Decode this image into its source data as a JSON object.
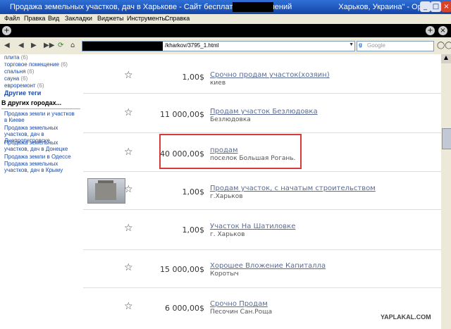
{
  "window": {
    "title_left": "Продажа земельных участков, дач в Харькове - Сайт бесплатных объявлений",
    "title_right": "Харьков, Украина\" - Opera",
    "minimize": "_",
    "maximize": "□",
    "close": "×"
  },
  "menu": [
    "Файл",
    "Правка",
    "Вид",
    "Закладки",
    "Виджеты",
    "Инструменты",
    "Справка"
  ],
  "address_bar": {
    "url": "/kharkov/3795_1.html"
  },
  "search": {
    "placeholder": "Google"
  },
  "sidebar": {
    "tags": [
      {
        "label": "плита",
        "count": "(6)"
      },
      {
        "label": "торговое помещение",
        "count": "(6)"
      },
      {
        "label": "спальня",
        "count": "(6)"
      },
      {
        "label": "сауна",
        "count": "(6)"
      },
      {
        "label": "евроремонт",
        "count": "(6)"
      }
    ],
    "other_tags": "Другие теги",
    "other_cities_heading": "В других городах...",
    "cities": [
      "Продажа земли и участков в Киеве",
      "Продажа земельных участков, дач в Днепропетровске",
      "Продажа земельных участков, дач в Донецке",
      "Продажа земли в Одессе",
      "Продажа земельных участков, дач в Крыму"
    ]
  },
  "listings": [
    {
      "price": "1,00$",
      "title": "Срочно продам участок(хозяин)",
      "location": "киев"
    },
    {
      "price": "11 000,00$",
      "title": "Продам участок Безлюдовка",
      "location": "Безлюдовка"
    },
    {
      "price": "40 000,00$",
      "title": "продам",
      "location": "поселок Большая Рогань."
    },
    {
      "price": "1,00$",
      "title": "Продам участок, с начатым строительством",
      "location": "г.Харьков"
    },
    {
      "price": "1,00$",
      "title": "Участок На Шатиловке",
      "location": "г. Харьков"
    },
    {
      "price": "15 000,00$",
      "title": "Хорошее Вложение Капиталла",
      "location": "Коротыч"
    },
    {
      "price": "6 000,00$",
      "title": "Срочно Продам",
      "location": "Песочин Сан.Роща"
    }
  ],
  "watermark": "YAPLAKAL.COM"
}
